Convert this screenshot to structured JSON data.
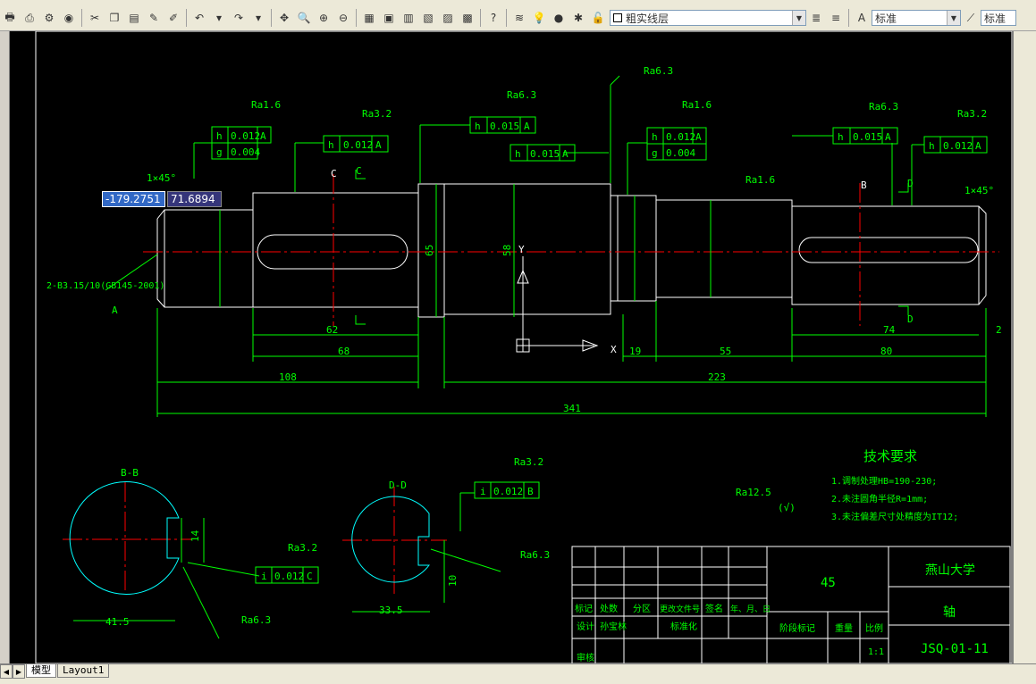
{
  "toolbar": {
    "layer_name": "粗实线层",
    "text_style": "标准",
    "dim_style": "标准"
  },
  "input": {
    "x_value": "-179.2751",
    "y_value": "71.6894"
  },
  "tabs": [
    {
      "label": "模型",
      "active": true
    },
    {
      "label": "Layout1",
      "active": false
    }
  ],
  "drawing": {
    "colors": {
      "line": "#00ff00",
      "outline": "#ffffff",
      "center": "#ff0000",
      "hatch": "#00ffff"
    },
    "chamfer_left": "1×45°",
    "chamfer_right": "1×45°",
    "center_hole": "2-B3.15/10(GB145-2001)",
    "datum_a": "A",
    "datum_b": "B",
    "datum_c": "C",
    "datum_d": "D",
    "section_b": "B-B",
    "section_d": "D-D",
    "label_c_section": "C",
    "label_d": "D",
    "roughness": [
      "Ra1.6",
      "Ra3.2",
      "Ra6.3",
      "Ra6.3",
      "Ra1.6",
      "Ra1.6",
      "Ra3.2",
      "Ra6.3",
      "Ra3.2",
      "Ra12.5",
      "Ra3.2",
      "Ra6.3",
      "Ra3.2",
      "Ra6.3"
    ],
    "tol_h1": [
      "h",
      "0.012",
      "A"
    ],
    "tol_g1": [
      "g",
      "0.004"
    ],
    "tol_h2": [
      "h",
      "0.012",
      "A"
    ],
    "tol_h3": [
      "h",
      "0.015",
      "A"
    ],
    "tol_h4": [
      "h",
      "0.015",
      "A"
    ],
    "tol_h5": [
      "h",
      "0.012",
      "A"
    ],
    "tol_g5": [
      "g",
      "0.004"
    ],
    "tol_h6": [
      "h",
      "0.015",
      "A"
    ],
    "tol_h7": [
      "h",
      "0.012",
      "A"
    ],
    "tol_i1": [
      "i",
      "0.012",
      "B"
    ],
    "tol_i2": [
      "i",
      "0.012",
      "C"
    ],
    "dims": {
      "d62": "62",
      "d68": "68",
      "d108": "108",
      "d223": "223",
      "d341": "341",
      "d19": "19",
      "d55": "55",
      "d80": "80",
      "d74": "74",
      "d2": "2",
      "d58": "58",
      "d65": "65",
      "d415": "41.5",
      "d335": "33.5",
      "d145": "14",
      "d10": "10"
    },
    "ucs_y": "Y",
    "ucs_x": "X",
    "tech_title": "技术要求",
    "tech_items": [
      "1.调制处理HB=190-230;",
      "2.未注圆角半径R=1mm;",
      "3.未注偏差尺寸处精度为IT12;"
    ],
    "rough_symbol_note": "(√)",
    "titleblock": {
      "material": "45",
      "company": "燕山大学",
      "part_name": "轴",
      "code": "JSQ-01-11",
      "scale_label": "比例",
      "scale": "1:1",
      "weight_label": "重量",
      "stage_label": "阶段标记",
      "row1": [
        "标记",
        "处数",
        "分区",
        "更改文件号",
        "签名",
        "年、月、日"
      ],
      "row2": [
        "设计",
        "孙宝林",
        "",
        "标准化"
      ],
      "row3": [
        "审核"
      ]
    }
  }
}
